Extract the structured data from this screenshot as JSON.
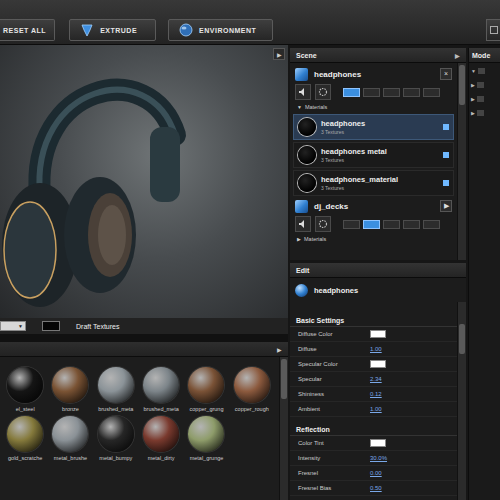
{
  "toolbar": {
    "reset": "RESET ALL",
    "extrude": "EXTRUDE",
    "environment": "ENVIRONMENT"
  },
  "viewport": {
    "menu_icon": "▶"
  },
  "view_bar": {
    "dropdown_arrow": "▼",
    "label": "Draft Textures"
  },
  "library": {
    "menu_icon": "▶",
    "rows": [
      [
        {
          "name": "el_steel",
          "color": "#151515"
        },
        {
          "name": "bronze",
          "color": "#7a5334"
        },
        {
          "name": "brushed_meta",
          "color": "#8b9398"
        },
        {
          "name": "brushed_meta",
          "color": "#7c8489"
        },
        {
          "name": "copper_grung",
          "color": "#7a5236"
        },
        {
          "name": "copper_rough",
          "color": "#8c5a3e"
        }
      ],
      [
        {
          "name": "gold_scratche",
          "color": "#857a3c"
        },
        {
          "name": "metal_brushe",
          "color": "#8a9196"
        },
        {
          "name": "metal_bumpy",
          "color": "#262626"
        },
        {
          "name": "metal_dirty",
          "color": "#7a3a2e"
        },
        {
          "name": "metal_grunge",
          "color": "#8e9c6a"
        }
      ]
    ]
  },
  "scene": {
    "title": "Scene",
    "menu_icon": "▶",
    "objects": [
      {
        "name": "headphones",
        "button": "×",
        "tabs": [
          {
            "selected": true
          },
          {
            "selected": false
          },
          {
            "selected": false
          },
          {
            "selected": false
          },
          {
            "selected": false
          }
        ],
        "materials": {
          "toggle": "▼",
          "label": "Materials",
          "expanded": true,
          "items": [
            {
              "name": "headphones",
              "textures": "3 Textures",
              "selected": true
            },
            {
              "name": "headphones metal",
              "textures": "3 Textures",
              "selected": false
            },
            {
              "name": "headphones_material",
              "textures": "3 Textures",
              "selected": false
            }
          ]
        }
      },
      {
        "name": "dj_decks",
        "button": "▶",
        "tabs": [
          {
            "selected": false
          },
          {
            "selected": true
          },
          {
            "selected": false
          },
          {
            "selected": false
          },
          {
            "selected": false
          }
        ],
        "materials": {
          "toggle": "▶",
          "label": "Materials",
          "expanded": false,
          "items": []
        }
      }
    ]
  },
  "edit": {
    "title": "Edit",
    "object": "headphones",
    "sections": [
      {
        "title": "Basic Settings",
        "rows": [
          {
            "label": "Diffuse Color",
            "kind": "color",
            "color": "#ffffff"
          },
          {
            "label": "Diffuse",
            "kind": "value",
            "value": "1.00"
          },
          {
            "label": "Specular Color",
            "kind": "color",
            "color": "#ffffff"
          },
          {
            "label": "Specular",
            "kind": "value",
            "value": "2.34"
          },
          {
            "label": "Shininess",
            "kind": "value",
            "value": "0.12"
          },
          {
            "label": "Ambient",
            "kind": "value",
            "value": "1.00"
          }
        ]
      },
      {
        "title": "Reflection",
        "rows": [
          {
            "label": "Color Tint",
            "kind": "color",
            "color": "#ffffff"
          },
          {
            "label": "Intensity",
            "kind": "value",
            "value": "30.0%"
          },
          {
            "label": "Fresnel",
            "kind": "value",
            "value": "0.00"
          },
          {
            "label": "Fresnel Bias",
            "kind": "value",
            "value": "0.50"
          }
        ]
      }
    ]
  },
  "models_panel": {
    "title": "Mode",
    "rows": [
      {
        "toggle": "▼"
      },
      {
        "toggle": "▶"
      },
      {
        "toggle": "▶"
      },
      {
        "toggle": "▶"
      }
    ]
  }
}
